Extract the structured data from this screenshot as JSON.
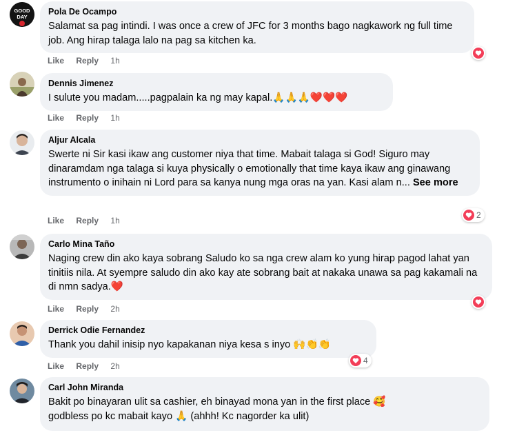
{
  "like_label": "Like",
  "reply_label": "Reply",
  "comments": [
    {
      "name": "Pola De Ocampo",
      "text": "Salamat sa pag intindi. I was once a crew of JFC for 3 months bago nagkawork ng full time job. Ang hirap talaga lalo na pag sa kitchen ka.",
      "time": "1h",
      "reaction_count": "",
      "avatar_text": "GOOD DAY"
    },
    {
      "name": "Dennis Jimenez",
      "text": "I sulute you madam.....pagpalain ka ng may kapal.🙏🙏🙏❤️❤️❤️",
      "time": "1h",
      "reaction_count": ""
    },
    {
      "name": "Aljur Alcala",
      "text": "Swerte ni Sir kasi ikaw ang customer niya that time. Mabait talaga si God! Siguro may dinaramdam nga talaga si kuya physically o emotionally that time kaya ikaw ang ginawang instrumento o inihain ni Lord para sa kanya nung mga oras na yan. Kasi alam n...",
      "see_more": "See more",
      "time": "1h",
      "reaction_count": "2"
    },
    {
      "name": "Carlo Mina Taño",
      "text": "Naging crew din ako kaya sobrang Saludo ko sa nga crew alam ko yung hirap pagod lahat yan tinitiis nila. At syempre saludo din ako kay ate sobrang bait at nakaka unawa sa pag kakamali na di nmn sadya.❤️",
      "time": "2h",
      "reaction_count": ""
    },
    {
      "name": "Derrick Odie Fernandez",
      "text": "Thank you dahil inisip nyo kapakanan niya kesa s inyo 🙌👏👏",
      "time": "2h",
      "reaction_count": "4"
    },
    {
      "name": "Carl John Miranda",
      "text": "Bakit po binayaran ulit sa cashier, eh binayad mona yan in the first place 🥰",
      "text2": "godbless po kc mabait kayo 🙏 (ahhh! Kc nagorder ka ulit)",
      "time": "",
      "reaction_count": ""
    }
  ],
  "colors": {
    "bubble": "#f0f2f5",
    "meta": "#65676b",
    "heart": "#f33e58"
  }
}
